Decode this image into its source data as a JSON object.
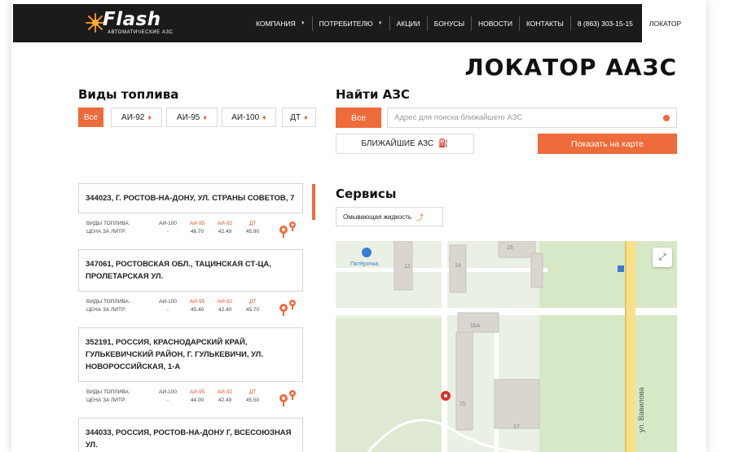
{
  "header": {
    "logo_text": "Flash",
    "logo_sub": "АВТОМАТИЧЕСКИЕ АЗС",
    "nav": [
      {
        "label": "КОМПАНИЯ",
        "caret": true
      },
      {
        "label": "ПОТРЕБИТЕЛЮ",
        "caret": true
      },
      {
        "label": "АКЦИИ",
        "caret": false
      },
      {
        "label": "БОНУСЫ",
        "caret": false
      },
      {
        "label": "НОВОСТИ",
        "caret": false
      },
      {
        "label": "КОНТАКТЫ",
        "caret": false
      },
      {
        "label": "8 (863) 303-15-15",
        "caret": false
      }
    ],
    "active_tab": "ЛОКАТОР"
  },
  "page_title": "ЛОКАТОР ААЗС",
  "fuel_section": {
    "title": "Виды топлива",
    "chips": [
      "Все",
      "АИ-92",
      "АИ-95",
      "АИ-100",
      "ДТ"
    ]
  },
  "search_section": {
    "title": "Найти АЗС",
    "all_button": "Все",
    "placeholder": "Адрес для поиска ближайшего АЗС",
    "nearest_button": "БЛИЖАЙШИЕ АЗС",
    "show_map_button": "Показать на карте"
  },
  "stations": [
    {
      "address": "344023, Г. РОСТОВ-НА-ДОНУ, УЛ. СТРАНЫ СОВЕТОВ, 7",
      "fuel_label": "ВИДЫ ТОПЛИВА:",
      "price_label": "ЦЕНА ЗА ЛИТР:",
      "fuels": [
        "АИ-100",
        "АИ-95",
        "АИ-92",
        "ДТ"
      ],
      "prices": [
        "-",
        "46.70",
        "42.49",
        "45.90"
      ]
    },
    {
      "address": "347061, РОСТОВСКАЯ ОБЛ., ТАЦИНСКАЯ СТ-ЦА, ПРОЛЕТАРСКАЯ УЛ.",
      "fuel_label": "ВИДЫ ТОПЛИВА:",
      "price_label": "ЦЕНА ЗА ЛИТР:",
      "fuels": [
        "АИ-100",
        "АИ-95",
        "АИ-92",
        "ДТ"
      ],
      "prices": [
        "-",
        "45.40",
        "42.40",
        "45.70"
      ]
    },
    {
      "address": "352191, РОССИЯ, КРАСНОДАРСКИЙ КРАЙ, ГУЛЬКЕВИЧСКИЙ РАЙОН, Г. ГУЛЬКЕВИЧИ, УЛ. НОВОРОССИЙСКАЯ, 1-А",
      "fuel_label": "ВИДЫ ТОПЛИВА:",
      "price_label": "ЦЕНА ЗА ЛИТР:",
      "fuels": [
        "АИ-100",
        "АИ-95",
        "АИ-92",
        "ДТ"
      ],
      "prices": [
        "-",
        "44.00",
        "42.49",
        "45.50"
      ]
    },
    {
      "address": "344033, РОССИЯ, РОСТОВ-НА-ДОНУ Г, ВСЕСОЮЗНАЯ УЛ."
    }
  ],
  "services_section": {
    "title": "Сервисы",
    "chip": "Омывающая жидкость"
  },
  "map": {
    "poi_label": "Пятёрочка",
    "street_label": "ул. Вавилова",
    "building_numbers": [
      "12",
      "14",
      "16",
      "16А",
      "15",
      "17"
    ]
  },
  "colors": {
    "accent": "#ee6b3b",
    "header_bg": "#1b1b1b"
  }
}
